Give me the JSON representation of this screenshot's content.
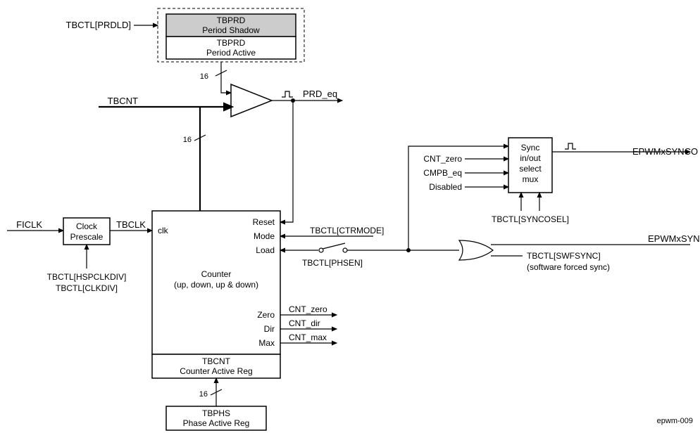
{
  "registers": {
    "tbprd_shadow_top": "TBPRD",
    "tbprd_shadow_bot": "Period Shadow",
    "tbprd_active_top": "TBPRD",
    "tbprd_active_bot": "Period Active",
    "tbcnt_top": "TBCNT",
    "tbcnt_bot": "Counter Active Reg",
    "tbphs_top": "TBPHS",
    "tbphs_bot": "Phase Active Reg"
  },
  "blocks": {
    "clock_prescale": "Clock\nPrescale",
    "counter_top": "Counter",
    "counter_bot": "(up, down, up & down)",
    "sync_mux_l1": "Sync",
    "sync_mux_l2": "in/out",
    "sync_mux_l3": "select",
    "sync_mux_l4": "mux"
  },
  "signals": {
    "tbctl_prdld": "TBCTL[PRDLD]",
    "tbcnt": "TBCNT",
    "ficlk": "FICLK",
    "tbclk": "TBCLK",
    "tbctl_hspclkdiv": "TBCTL[HSPCLKDIV]",
    "tbctl_clkdiv": "TBCTL[CLKDIV]",
    "prd_eq": "PRD_eq",
    "cnt_zero_in": "CNT_zero",
    "cmpb_eq": "CMPB_eq",
    "disabled": "Disabled",
    "epwmxsynco": "EPWMxSYNCO",
    "epwmxsynci": "EPWMxSYNCI",
    "tbctl_syncosel": "TBCTL[SYNCOSEL]",
    "tbctl_ctrmode": "TBCTL[CTRMODE]",
    "tbctl_phsen": "TBCTL[PHSEN]",
    "tbctl_swfsync": "TBCTL[SWFSYNC]",
    "swfsync_sub": "(software forced sync)",
    "cnt_zero": "CNT_zero",
    "cnt_dir": "CNT_dir",
    "cnt_max": "CNT_max",
    "bus16_a": "16",
    "bus16_b": "16",
    "bus16_c": "16"
  },
  "ports": {
    "clk": "clk",
    "reset": "Reset",
    "mode": "Mode",
    "load": "Load",
    "zero": "Zero",
    "dir": "Dir",
    "max": "Max"
  },
  "footer": {
    "id": "epwm-009"
  }
}
